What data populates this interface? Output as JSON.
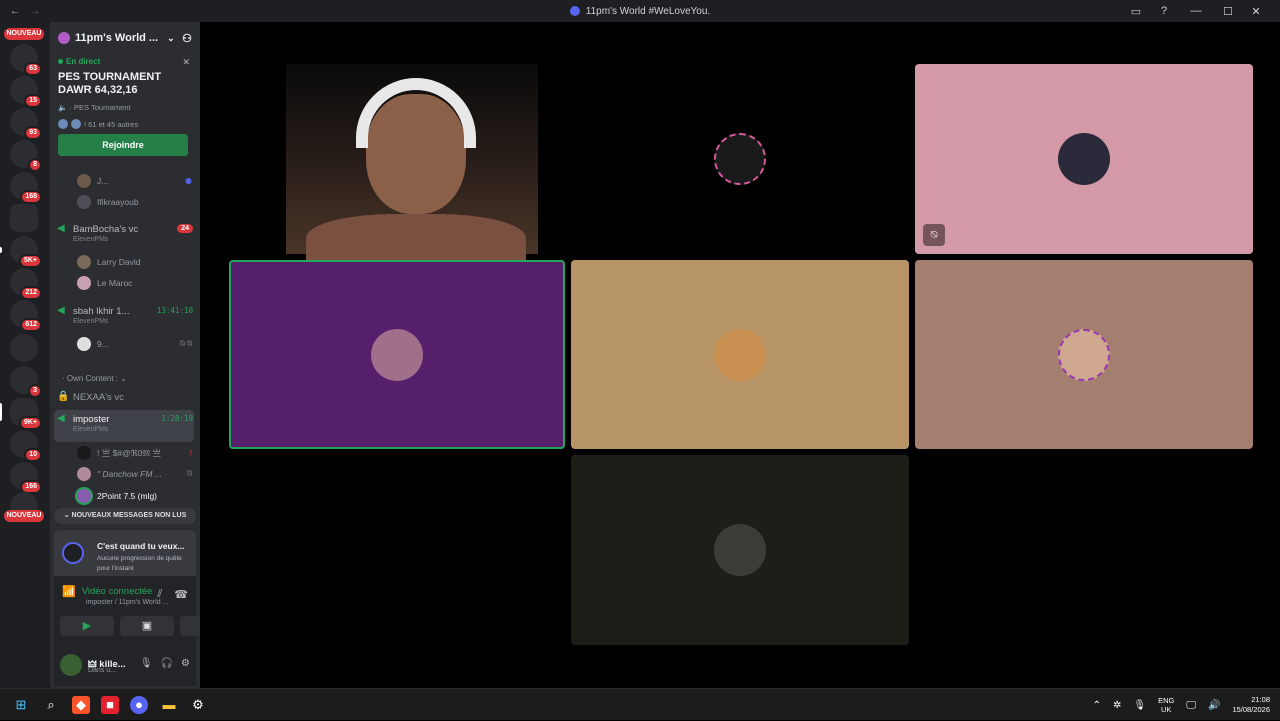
{
  "window": {
    "title": "11pm's World #WeLoveYou.",
    "back": "←",
    "forward": "→",
    "controls": [
      "▭",
      "?",
      "—",
      "☐",
      "✕"
    ]
  },
  "guilds": {
    "items": [
      {
        "badge": "63",
        "color": "#3a2a2a"
      },
      {
        "badge": "15",
        "color": "#2a2a3a"
      },
      {
        "badge": "93",
        "color": "#1a3d6b"
      },
      {
        "badge": "8",
        "color": "#163a7a"
      },
      {
        "badge": "168",
        "color": "#101010"
      },
      {
        "badge": "",
        "color": "#5865f2"
      },
      {
        "badge": "5K+",
        "color": "#f2f2f2"
      },
      {
        "badge": "212",
        "color": "#2b4a6b"
      },
      {
        "badge": "612",
        "color": "#7a1010"
      },
      {
        "badge": "",
        "color": "#1e3a8a"
      },
      {
        "badge": "3",
        "color": "#202020"
      },
      {
        "badge": "9K+",
        "color": "#123a4a"
      },
      {
        "badge": "10",
        "color": "#6a1a7a"
      },
      {
        "badge": "166",
        "color": "#101030"
      },
      {
        "badge": "",
        "color": "#40306a"
      }
    ],
    "new_label": "NOUVEAU"
  },
  "server": {
    "name": "11pm's World ...",
    "chevron": "⌄",
    "invite_icon": "⚇"
  },
  "event": {
    "status": "En directe",
    "status_label": "En direct",
    "close": "✕",
    "name": "PES TOURNAMENT DAWR 64,32,16",
    "channel": "PES Tournament",
    "others": "! 61 et 45 autres",
    "join_label": "Rejoindre"
  },
  "channels": {
    "members_top": [
      {
        "name": "J...",
        "avatar": "#6b5a4a"
      },
      {
        "name": "Ifikraayoub",
        "avatar": "#4a4e58"
      }
    ],
    "bambocha": {
      "name": "BamBocha's vc",
      "sub": "ElevenPMs",
      "badge": "24"
    },
    "bambocha_members": [
      {
        "name": "Larry David",
        "avatar": "#7a6a5a"
      },
      {
        "name": "Le Maroc",
        "avatar": "#c8a0b0"
      }
    ],
    "sbah": {
      "name": "sbah lkhir 1...",
      "sub": "ElevenPMs",
      "time": "13:41:10"
    },
    "sbah_members": [
      {
        "name": "9...",
        "avatar": "#e0e0e0"
      }
    ],
    "category": "Own Content :",
    "nexaa": {
      "name": "NEXAA's vc"
    },
    "imposter": {
      "name": "imposter",
      "sub": "ElevenPMs",
      "time": "1:28:19"
    },
    "imposter_members": [
      {
        "name": "! 亗 $#@ℜ0𝔐 亗",
        "avatar": "#1a1a1a",
        "mark": "!"
      },
      {
        "name": "\" Danchow FM ...",
        "avatar": "#b08a9a",
        "mark": "⍉"
      },
      {
        "name": "2Point 7.5 (mlg)",
        "avatar": "#8a5ab0",
        "mark": ""
      }
    ]
  },
  "unread_label": "NOUVEAUX MESSAGES NON LUS",
  "quest": {
    "title": "C'est quand tu veux...",
    "subtitle": "Aucune progression de quête pour l'instant"
  },
  "voice": {
    "status": "Vidéo connectée",
    "location": "imposter / 11pm's World ..."
  },
  "user": {
    "name": "🜲 kille...",
    "status": "Dans u..."
  },
  "tiles": {
    "colors": [
      "#000000",
      "#d59aa7",
      "#561f6b",
      "#b69466",
      "#a47e6e",
      "#1b1f17"
    ]
  },
  "taskbar": {
    "lang_top": "ENG",
    "lang_bottom": "UK",
    "time": "21:08",
    "date": "15/08/2026"
  }
}
